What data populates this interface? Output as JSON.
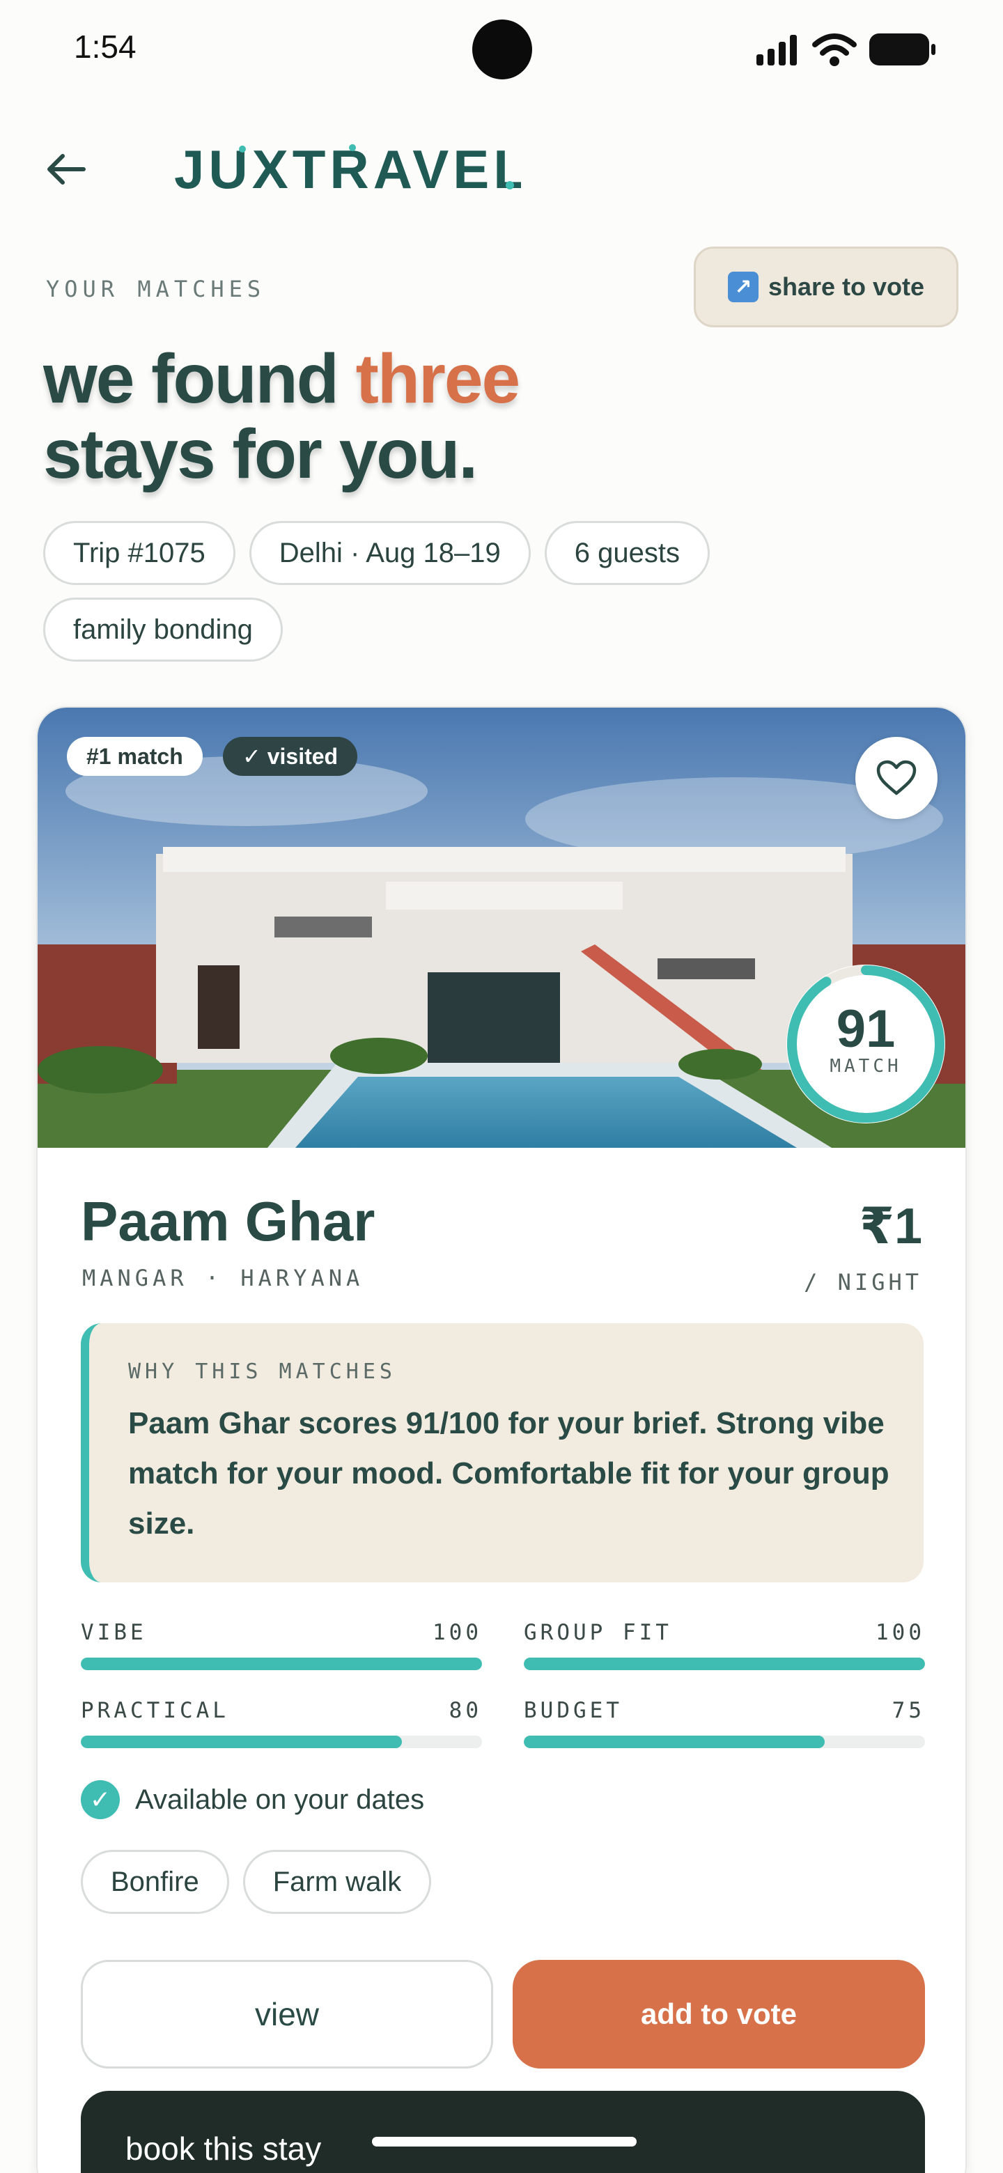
{
  "status_bar": {
    "time": "1:54"
  },
  "header": {
    "brand": "JUXTRAVEL."
  },
  "page": {
    "eyebrow": "YOUR MATCHES",
    "share_label": "share to vote",
    "headline_pre": "we found ",
    "headline_accent": "three",
    "headline_post": "stays for you.",
    "chips": [
      "Trip #1075",
      "Delhi · Aug 18–19",
      "6 guests",
      "family bonding"
    ]
  },
  "card": {
    "rank_badge": "#1 match",
    "visited_badge": "✓ visited",
    "match_score": "91",
    "match_label": "MATCH",
    "match_value": 0.91,
    "title": "Paam Ghar",
    "location": "MANGAR · HARYANA",
    "price": "₹1",
    "per_night": "/ NIGHT",
    "why": {
      "label": "WHY THIS MATCHES",
      "text": "Paam Ghar scores 91/100 for your brief. Strong vibe match for your mood. Comfortable fit for your group size."
    },
    "scores": [
      {
        "label": "VIBE",
        "value": "100",
        "fraction": 1.0
      },
      {
        "label": "GROUP FIT",
        "value": "100",
        "fraction": 1.0
      },
      {
        "label": "PRACTICAL",
        "value": "80",
        "fraction": 0.8
      },
      {
        "label": "BUDGET",
        "value": "75",
        "fraction": 0.75
      }
    ],
    "availability": "Available on your dates",
    "amenities": [
      "Bonfire",
      "Farm walk"
    ],
    "view_label": "view",
    "vote_label": "add to vote",
    "book_label": "book this stay"
  },
  "colors": {
    "accent": "#d6714a",
    "teal": "#40bdb2",
    "ink": "#2a4b45",
    "dark": "#1f2c28"
  },
  "icons": [
    "back-arrow-icon",
    "heart-icon",
    "check-icon",
    "share-icon"
  ]
}
